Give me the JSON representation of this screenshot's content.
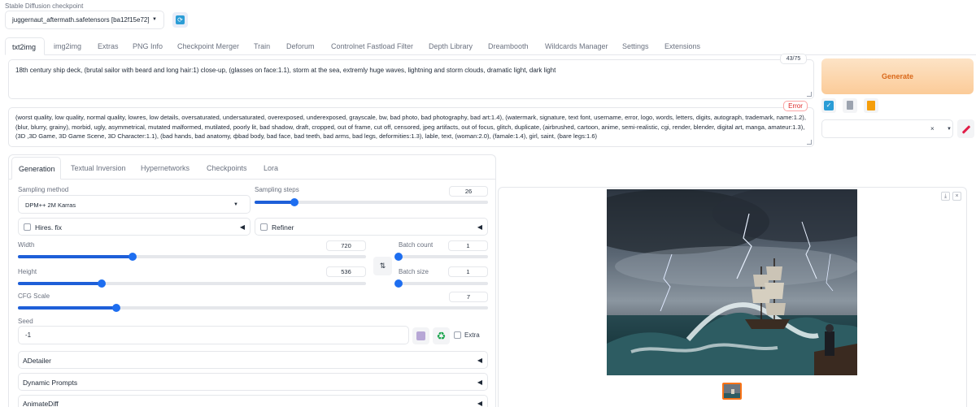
{
  "checkpoint": {
    "label": "Stable Diffusion checkpoint",
    "value": "juggernaut_aftermath.safetensors [ba12f15e72]"
  },
  "main_tabs": [
    "txt2img",
    "img2img",
    "Extras",
    "PNG Info",
    "Checkpoint Merger",
    "Train",
    "Deforum",
    "Controlnet Fastload Filter",
    "Depth Library",
    "Dreambooth",
    "Wildcards Manager",
    "Settings",
    "Extensions"
  ],
  "prompt": {
    "text": "18th century ship deck, (brutal sailor with beard and long hair:1) close-up,  (glasses on face:1.1), storm at the sea, extremly huge waves, lightning and storm clouds, dramatic light, dark light",
    "token_count": "43/75"
  },
  "negative_prompt": {
    "text": "(worst quality, low quality, normal quality, lowres, low details, oversaturated, undersaturated, overexposed, underexposed, grayscale, bw, bad photo, bad photography, bad art:1.4), (watermark, signature, text font, username, error, logo, words, letters, digits, autograph, trademark, name:1.2), (blur, blurry, grainy), morbid, ugly, asymmetrical, mutated malformed, mutilated, poorly lit, bad shadow, draft, cropped, out of frame, cut off, censored, jpeg artifacts, out of focus, glitch, duplicate, (airbrushed, cartoon, anime, semi-realistic, cgi, render, blender, digital art, manga, amateur:1.3), (3D ,3D Game, 3D Game Scene, 3D Character:1.1), (bad hands, bad anatomy, фbad body, bad face, bad teeth, bad arms, bad legs, deformities:1.3), lable, text, (woman:2.0), (famale:1.4), girl, saint, (bare legs:1.6)",
    "status": "Error"
  },
  "generate_label": "Generate",
  "styles": {
    "clear": "×",
    "caret": "▾"
  },
  "sub_tabs": [
    "Generation",
    "Textual Inversion",
    "Hypernetworks",
    "Checkpoints",
    "Lora"
  ],
  "sampling": {
    "method_label": "Sampling method",
    "method_value": "DPM++ 2M Karras",
    "steps_label": "Sampling steps",
    "steps_value": "26",
    "steps_fraction": 0.17
  },
  "hires_fix_label": "Hires. fix",
  "refiner_label": "Refiner",
  "dims": {
    "width_label": "Width",
    "width_value": "720",
    "width_fraction": 0.33,
    "height_label": "Height",
    "height_value": "536",
    "height_fraction": 0.24,
    "swap_icon": "⇅"
  },
  "batch": {
    "count_label": "Batch count",
    "count_value": "1",
    "count_fraction": 0.0,
    "size_label": "Batch size",
    "size_value": "1",
    "size_fraction": 0.0
  },
  "cfg": {
    "label": "CFG Scale",
    "value": "7",
    "fraction": 0.21
  },
  "seed": {
    "label": "Seed",
    "value": "-1",
    "extra_label": "Extra",
    "recycle_icon": "♻"
  },
  "accordions": [
    "ADetailer",
    "Dynamic Prompts",
    "AnimateDiff"
  ],
  "output": {
    "download_icon": "⤓",
    "close_icon": "×"
  },
  "icons": {
    "refresh": "refresh-icon",
    "paste": "check-icon",
    "trash": "trash-icon",
    "clipboard": "clipboard-icon",
    "pencil": "pencil-icon",
    "dice": "dice-icon"
  },
  "colors": {
    "accent": "#1e6ef0",
    "generate_text": "#d9681a",
    "error": "#dc2626",
    "thumb_border": "#f97316"
  }
}
